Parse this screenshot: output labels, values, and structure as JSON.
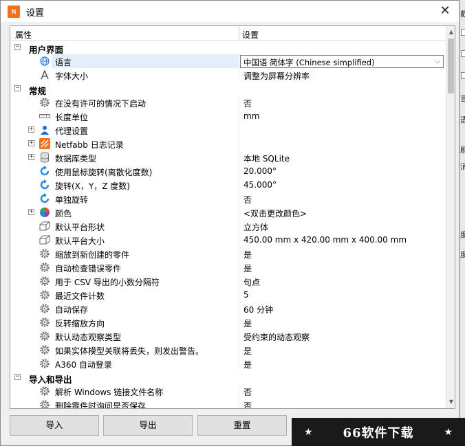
{
  "window": {
    "title": "设置",
    "icon_text": "N",
    "close_glyph": "✕"
  },
  "grid": {
    "header_property": "属性",
    "header_setting": "设置"
  },
  "rows": [
    {
      "type": "category",
      "expand": "−",
      "label": "用户界面"
    },
    {
      "type": "item",
      "icon": "globe-icon",
      "label": "语言",
      "value": "中国语 简体字 (Chinese simplified)",
      "selected": true,
      "dropdown": true
    },
    {
      "type": "item",
      "icon": "font-icon",
      "label": "字体大小",
      "value": "调整为屏幕分辨率"
    },
    {
      "type": "category",
      "expand": "−",
      "label": "常规"
    },
    {
      "type": "item",
      "icon": "gear-icon",
      "label": "在没有许可的情况下启动",
      "value": "否"
    },
    {
      "type": "item",
      "icon": "ruler-icon",
      "label": "长度单位",
      "value": "mm"
    },
    {
      "type": "item",
      "icon": "user-icon",
      "label": "代理设置",
      "value": "",
      "expand": "+"
    },
    {
      "type": "item",
      "icon": "netfabb-icon",
      "label": "Netfabb 日志记录",
      "value": "",
      "expand": "+"
    },
    {
      "type": "item",
      "icon": "database-icon",
      "label": "数据库类型",
      "value": "本地 SQLite",
      "expand": "+"
    },
    {
      "type": "item",
      "icon": "rotate-icon",
      "label": "使用鼠标旋转(离散化度数)",
      "value": "20.000°"
    },
    {
      "type": "item",
      "icon": "rotate-icon",
      "label": "旋转(X，Y，Z 度数)",
      "value": "45.000°"
    },
    {
      "type": "item",
      "icon": "rotate-icon",
      "label": "单独旋转",
      "value": "否"
    },
    {
      "type": "item",
      "icon": "color-wheel-icon",
      "label": "颜色",
      "value": "<双击更改颜色>",
      "expand": "+"
    },
    {
      "type": "item",
      "icon": "platform-icon",
      "label": "默认平台形状",
      "value": "立方体"
    },
    {
      "type": "item",
      "icon": "platform-icon",
      "label": "默认平台大小",
      "value": "450.00 mm x 420.00 mm x 400.00 mm"
    },
    {
      "type": "item",
      "icon": "gear-icon",
      "label": "缩放到新创建的零件",
      "value": "是"
    },
    {
      "type": "item",
      "icon": "gear-icon",
      "label": "自动检查错误零件",
      "value": "是"
    },
    {
      "type": "item",
      "icon": "gear-icon",
      "label": "用于 CSV 导出的小数分隔符",
      "value": "句点"
    },
    {
      "type": "item",
      "icon": "gear-icon",
      "label": "最近文件计数",
      "value": "5"
    },
    {
      "type": "item",
      "icon": "gear-icon",
      "label": "自动保存",
      "value": "60 分钟"
    },
    {
      "type": "item",
      "icon": "gear-icon",
      "label": "反转缩放方向",
      "value": "是"
    },
    {
      "type": "item",
      "icon": "gear-icon",
      "label": "默认动态观察类型",
      "value": "受约束的动态观察"
    },
    {
      "type": "item",
      "icon": "gear-icon",
      "label": "如果实体模型关联将丢失，则发出警告。",
      "value": "是"
    },
    {
      "type": "item",
      "icon": "gear-icon",
      "label": "A360 自动登录",
      "value": "是"
    },
    {
      "type": "category",
      "expand": "−",
      "label": "导入和导出"
    },
    {
      "type": "item",
      "icon": "gear-icon",
      "label": "解析 Windows 链接文件名称",
      "value": "否"
    },
    {
      "type": "item",
      "icon": "gear-icon",
      "label": "删除零件时询问是否保存",
      "value": "否"
    }
  ],
  "buttons": {
    "import": "导入",
    "export": "导出",
    "reset": "重置"
  },
  "behind_window": {
    "chars": [
      "截",
      "言",
      "透",
      "刷",
      "消",
      "度",
      "度"
    ]
  },
  "watermark": {
    "text": "66软件下载",
    "star": "★"
  },
  "colors": {
    "selected_row": "#e5eefb",
    "netfabb_orange": "#f2711c",
    "rotate_blue": "#1e88e5"
  }
}
